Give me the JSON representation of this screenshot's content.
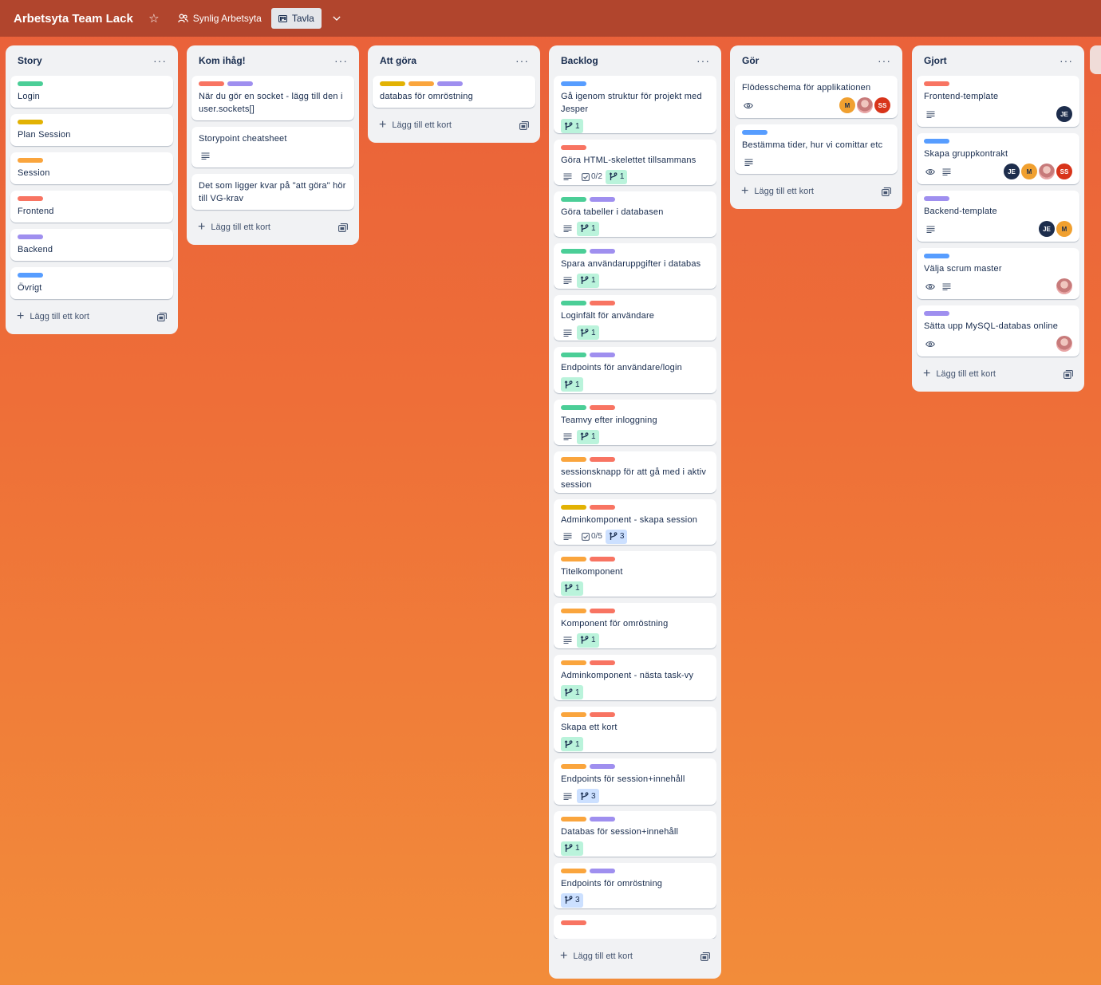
{
  "board": {
    "title": "Arbetsyta Team Lack",
    "visibility": "Synlig Arbetsyta",
    "view": "Tavla"
  },
  "add_card_label": "Lägg till ett kort",
  "lists": [
    {
      "title": "Story",
      "cards": [
        {
          "labels": [
            "green"
          ],
          "title": "Login"
        },
        {
          "labels": [
            "yellow"
          ],
          "title": "Plan Session"
        },
        {
          "labels": [
            "orange"
          ],
          "title": "Session"
        },
        {
          "labels": [
            "red"
          ],
          "title": "Frontend"
        },
        {
          "labels": [
            "purple"
          ],
          "title": "Backend"
        },
        {
          "labels": [
            "blue"
          ],
          "title": "Övrigt"
        }
      ]
    },
    {
      "title": "Kom ihåg!",
      "cards": [
        {
          "labels": [
            "red",
            "purple"
          ],
          "title": "När du gör en socket - lägg till den i user.sockets[]"
        },
        {
          "labels": [],
          "title": "Storypoint cheatsheet",
          "desc": true
        },
        {
          "labels": [],
          "title": "Det som ligger kvar på \"att göra\" hör till VG-krav"
        }
      ]
    },
    {
      "title": "Att göra",
      "cards": [
        {
          "labels": [
            "yellow",
            "orange",
            "purple"
          ],
          "title": "databas för omröstning"
        }
      ]
    },
    {
      "title": "Backlog",
      "cards": [
        {
          "labels": [
            "blue"
          ],
          "title": "Gå igenom struktur för projekt med Jesper",
          "gh": {
            "count": "1",
            "color": "green"
          }
        },
        {
          "labels": [
            "red"
          ],
          "title": "Göra HTML-skelettet tillsammans",
          "desc": true,
          "checklist": "0/2",
          "gh": {
            "count": "1",
            "color": "green"
          }
        },
        {
          "labels": [
            "green",
            "purple"
          ],
          "title": "Göra tabeller i databasen",
          "desc": true,
          "gh": {
            "count": "1",
            "color": "green"
          }
        },
        {
          "labels": [
            "green",
            "purple"
          ],
          "title": "Spara användaruppgifter i databas",
          "desc": true,
          "gh": {
            "count": "1",
            "color": "green"
          }
        },
        {
          "labels": [
            "green",
            "red"
          ],
          "title": "Loginfält för användare",
          "desc": true,
          "gh": {
            "count": "1",
            "color": "green"
          }
        },
        {
          "labels": [
            "green",
            "purple"
          ],
          "title": "Endpoints för användare/login",
          "gh": {
            "count": "1",
            "color": "green"
          }
        },
        {
          "labels": [
            "green",
            "red"
          ],
          "title": "Teamvy efter inloggning",
          "desc": true,
          "gh": {
            "count": "1",
            "color": "green"
          }
        },
        {
          "labels": [
            "orange",
            "red"
          ],
          "title": "sessionsknapp för att gå med i aktiv session"
        },
        {
          "labels": [
            "yellow",
            "red"
          ],
          "title": "Adminkomponent - skapa session",
          "desc": true,
          "checklist": "0/5",
          "gh": {
            "count": "3",
            "color": "blue"
          }
        },
        {
          "labels": [
            "orange",
            "red"
          ],
          "title": "Titelkomponent",
          "gh": {
            "count": "1",
            "color": "green"
          }
        },
        {
          "labels": [
            "orange",
            "red"
          ],
          "title": "Komponent för omröstning",
          "desc": true,
          "gh": {
            "count": "1",
            "color": "green"
          }
        },
        {
          "labels": [
            "orange",
            "red"
          ],
          "title": "Adminkomponent - nästa task-vy",
          "gh": {
            "count": "1",
            "color": "green"
          }
        },
        {
          "labels": [
            "orange",
            "red"
          ],
          "title": "Skapa ett kort",
          "gh": {
            "count": "1",
            "color": "green"
          }
        },
        {
          "labels": [
            "orange",
            "purple"
          ],
          "title": "Endpoints för session+innehåll",
          "desc": true,
          "gh": {
            "count": "3",
            "color": "blue"
          }
        },
        {
          "labels": [
            "orange",
            "purple"
          ],
          "title": "Databas för session+innehåll",
          "gh": {
            "count": "1",
            "color": "green"
          }
        },
        {
          "labels": [
            "orange",
            "purple"
          ],
          "title": "Endpoints för omröstning",
          "gh": {
            "count": "3",
            "color": "blue"
          }
        },
        {
          "labels": [
            "red"
          ],
          "title": "",
          "partial": true
        }
      ]
    },
    {
      "title": "Gör",
      "cards": [
        {
          "labels": [],
          "title": "Flödesschema för applikationen",
          "eye": true,
          "members": [
            "M",
            "photo",
            "SS"
          ]
        },
        {
          "labels": [
            "blue"
          ],
          "title": "Bestämma tider, hur vi comittar etc",
          "desc": true
        }
      ]
    },
    {
      "title": "Gjort",
      "cards": [
        {
          "labels": [
            "red"
          ],
          "title": "Frontend-template",
          "desc": true,
          "members": [
            "JE"
          ]
        },
        {
          "labels": [
            "blue"
          ],
          "title": "Skapa gruppkontrakt",
          "eye": true,
          "desc": true,
          "members": [
            "JE",
            "M",
            "photo",
            "SS"
          ]
        },
        {
          "labels": [
            "purple"
          ],
          "title": "Backend-template",
          "desc": true,
          "members": [
            "JE",
            "M"
          ]
        },
        {
          "labels": [
            "blue"
          ],
          "title": "Välja scrum master",
          "eye": true,
          "desc": true,
          "members": [
            "photo"
          ]
        },
        {
          "labels": [
            "purple"
          ],
          "title": "Sätta upp MySQL-databas online",
          "eye": true,
          "members": [
            "photo"
          ]
        }
      ]
    }
  ]
}
